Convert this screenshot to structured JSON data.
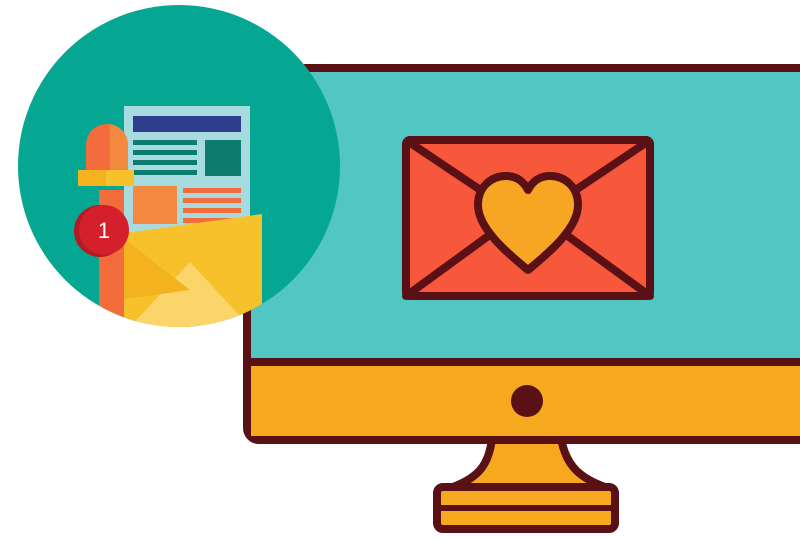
{
  "illustration": {
    "notification_badge_count": "1",
    "colors": {
      "outline": "#5a1115",
      "screen": "#52c6c2",
      "monitor_chin": "#f6a91e",
      "envelope": "#f7573b",
      "heart": "#f7a623",
      "circle_bg": "#05a792",
      "badge": "#d4202a",
      "newsletter_header": "#2e3e8e",
      "newsletter_lines": "#0c7b70",
      "newsletter_accent": "#f2893e",
      "small_envelope": "#f7c12c",
      "small_envelope_flap": "#fbd56a",
      "bell_orange": "#f26d3b",
      "bell_yellow": "#f7c12c"
    },
    "icons": [
      "monitor-icon",
      "love-letter-icon",
      "newsletter-icon",
      "bell-icon",
      "notification-badge",
      "envelope-icon"
    ]
  }
}
